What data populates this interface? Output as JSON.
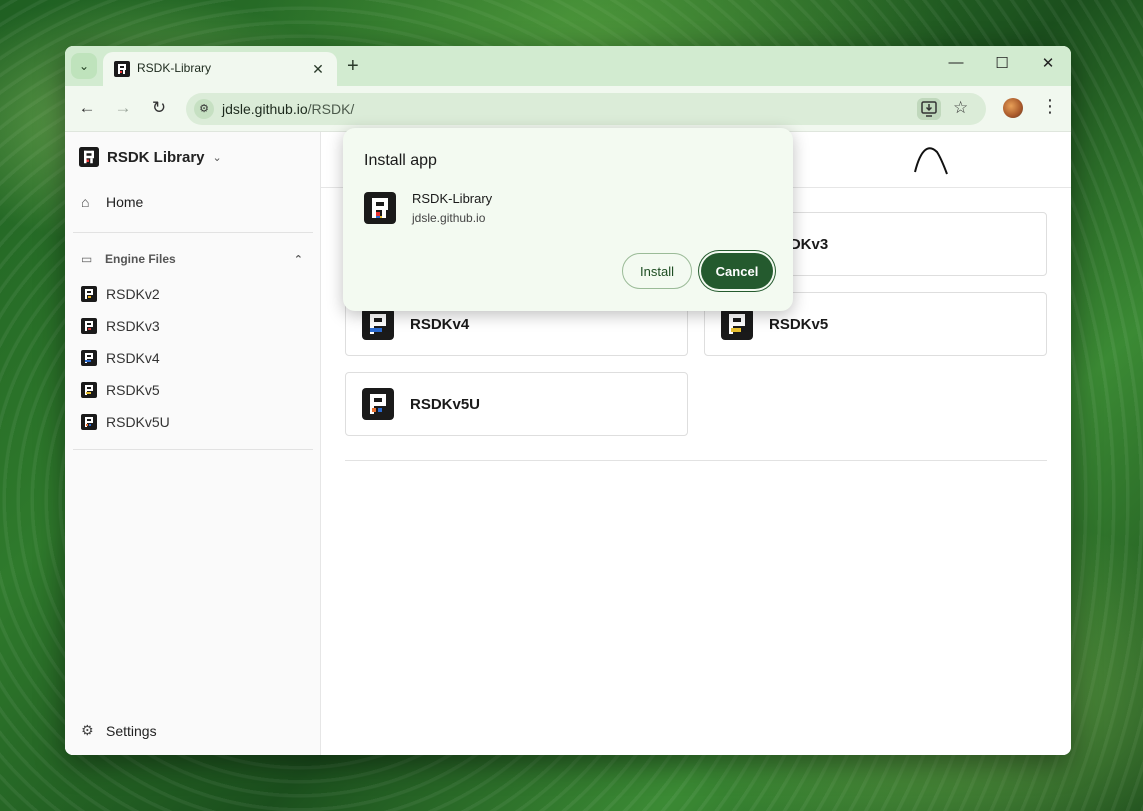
{
  "browser": {
    "tab": {
      "title": "RSDK-Library",
      "close_glyph": "✕",
      "favicon": "rsdk-logo-icon"
    },
    "new_tab_glyph": "+",
    "tab_search_glyph": "⌄",
    "window_controls": {
      "minimize": "—",
      "maximize": "☐",
      "close": "✕"
    },
    "nav": {
      "back": "←",
      "forward": "→",
      "reload": "↻"
    },
    "url": {
      "host": "jdsle.github.io",
      "path": "/RSDK/"
    },
    "icons": {
      "install": "install-app-icon",
      "star": "☆",
      "menu": "⋮"
    }
  },
  "sidebar": {
    "brand": "RSDK Library",
    "home": "Home",
    "group": "Engine Files",
    "items": [
      {
        "label": "RSDKv2",
        "accent": "#e8b020"
      },
      {
        "label": "RSDKv3",
        "accent": "#d03a3a"
      },
      {
        "label": "RSDKv4",
        "accent": "#2a6ad0"
      },
      {
        "label": "RSDKv5",
        "accent": "#e8c030"
      },
      {
        "label": "RSDKv5U",
        "accent": "#e87030"
      }
    ],
    "settings": "Settings"
  },
  "main": {
    "cards": [
      "RSDKv3",
      "RSDKv4",
      "RSDKv5",
      "RSDKv5U"
    ],
    "hidden_card_left": "RSDKv2"
  },
  "popup": {
    "title": "Install app",
    "app_name": "RSDK-Library",
    "origin": "jdsle.github.io",
    "install_label": "Install",
    "cancel_label": "Cancel"
  },
  "colors": {
    "accent": "#245a2e",
    "chrome": "#d2ebd0",
    "toolbar": "#f1f8ef"
  }
}
